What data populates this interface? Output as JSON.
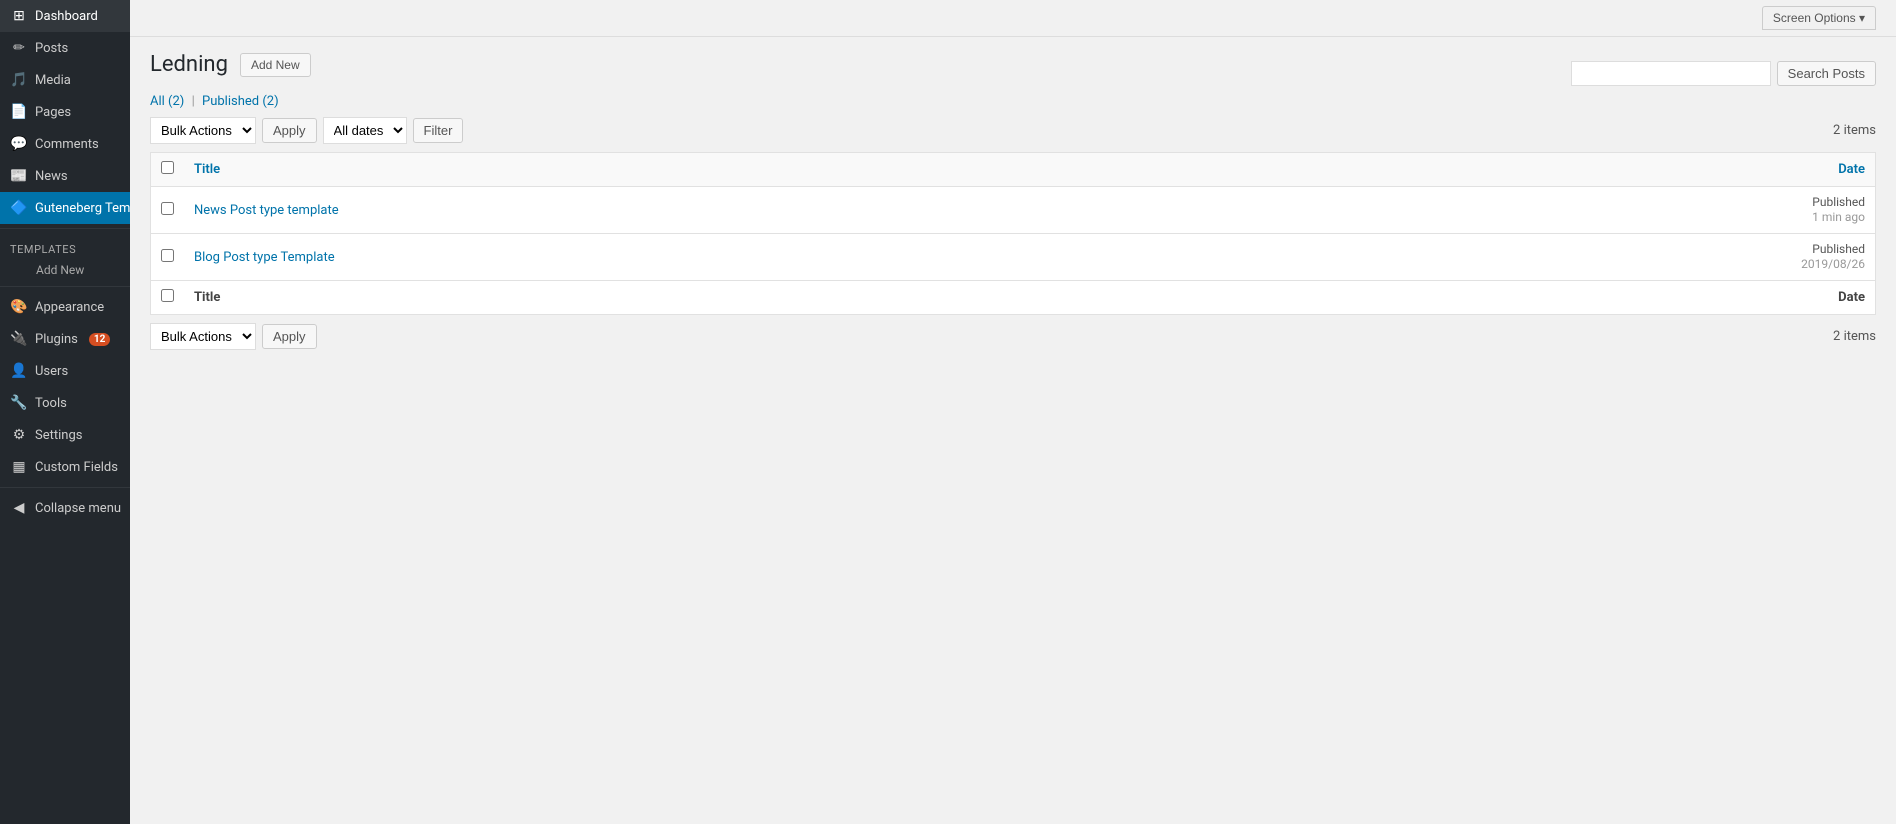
{
  "sidebar": {
    "items": [
      {
        "id": "dashboard",
        "label": "Dashboard",
        "icon": "⊞"
      },
      {
        "id": "posts",
        "label": "Posts",
        "icon": "📄"
      },
      {
        "id": "media",
        "label": "Media",
        "icon": "🖼"
      },
      {
        "id": "pages",
        "label": "Pages",
        "icon": "📋"
      },
      {
        "id": "comments",
        "label": "Comments",
        "icon": "💬"
      },
      {
        "id": "news",
        "label": "News",
        "icon": "📰"
      },
      {
        "id": "gutenberg",
        "label": "Guteneberg Template Manager",
        "icon": "🔷",
        "active": true
      }
    ],
    "templates_section": "Templates",
    "add_new_sub": "Add New",
    "bottom_items": [
      {
        "id": "appearance",
        "label": "Appearance",
        "icon": "🎨"
      },
      {
        "id": "plugins",
        "label": "Plugins",
        "icon": "🔌",
        "badge": "12"
      },
      {
        "id": "users",
        "label": "Users",
        "icon": "👤"
      },
      {
        "id": "tools",
        "label": "Tools",
        "icon": "🔧"
      },
      {
        "id": "settings",
        "label": "Settings",
        "icon": "⚙"
      },
      {
        "id": "custom-fields",
        "label": "Custom Fields",
        "icon": "▦"
      }
    ],
    "collapse_label": "Collapse menu"
  },
  "topbar": {
    "screen_options": "Screen Options ▾"
  },
  "page": {
    "title": "Ledning",
    "add_new_label": "Add New",
    "filter_links": {
      "all_label": "All",
      "all_count": "(2)",
      "published_label": "Published",
      "published_count": "(2)"
    },
    "search_placeholder": "",
    "search_btn": "Search Posts",
    "actions_top": {
      "bulk_actions": "Bulk Actions",
      "apply": "Apply",
      "all_dates": "All dates",
      "filter": "Filter",
      "items_count": "2 items"
    },
    "table": {
      "col_title": "Title",
      "col_date": "Date",
      "rows": [
        {
          "title": "News Post type template",
          "status": "Published",
          "date": "1 min ago"
        },
        {
          "title": "Blog Post type Template",
          "status": "Published",
          "date": "2019/08/26"
        }
      ]
    },
    "actions_bottom": {
      "bulk_actions": "Bulk Actions",
      "apply": "Apply",
      "items_count": "2 items"
    }
  }
}
